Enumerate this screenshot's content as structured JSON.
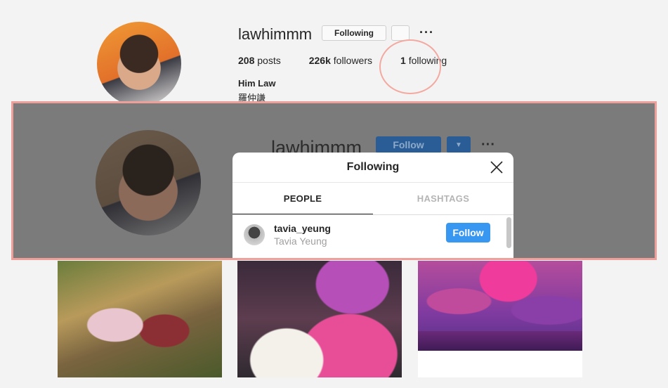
{
  "profile": {
    "username": "lawhimmm",
    "following_button": "Following",
    "more_icon": "···",
    "stats": {
      "posts_count": "208",
      "posts_label": " posts",
      "followers_count": "226k",
      "followers_label": " followers",
      "following_count": "1",
      "following_label": " following"
    },
    "full_name": "Him Law",
    "bio": "羅仲謙"
  },
  "overlay": {
    "username": "lawhimmm",
    "follow_button": "Follow",
    "caret_icon": "▼",
    "more_icon": "···"
  },
  "modal": {
    "title": "Following",
    "tabs": [
      {
        "label": "PEOPLE",
        "active": true
      },
      {
        "label": "HASHTAGS",
        "active": false
      }
    ],
    "users": [
      {
        "handle": "tavia_yeung",
        "full_name": "Tavia Yeung",
        "button": "Follow"
      }
    ]
  },
  "colors": {
    "annotation": "#ef9f99",
    "follow_blue": "#3897f0",
    "overlay_dim": "#7b7b7b"
  }
}
